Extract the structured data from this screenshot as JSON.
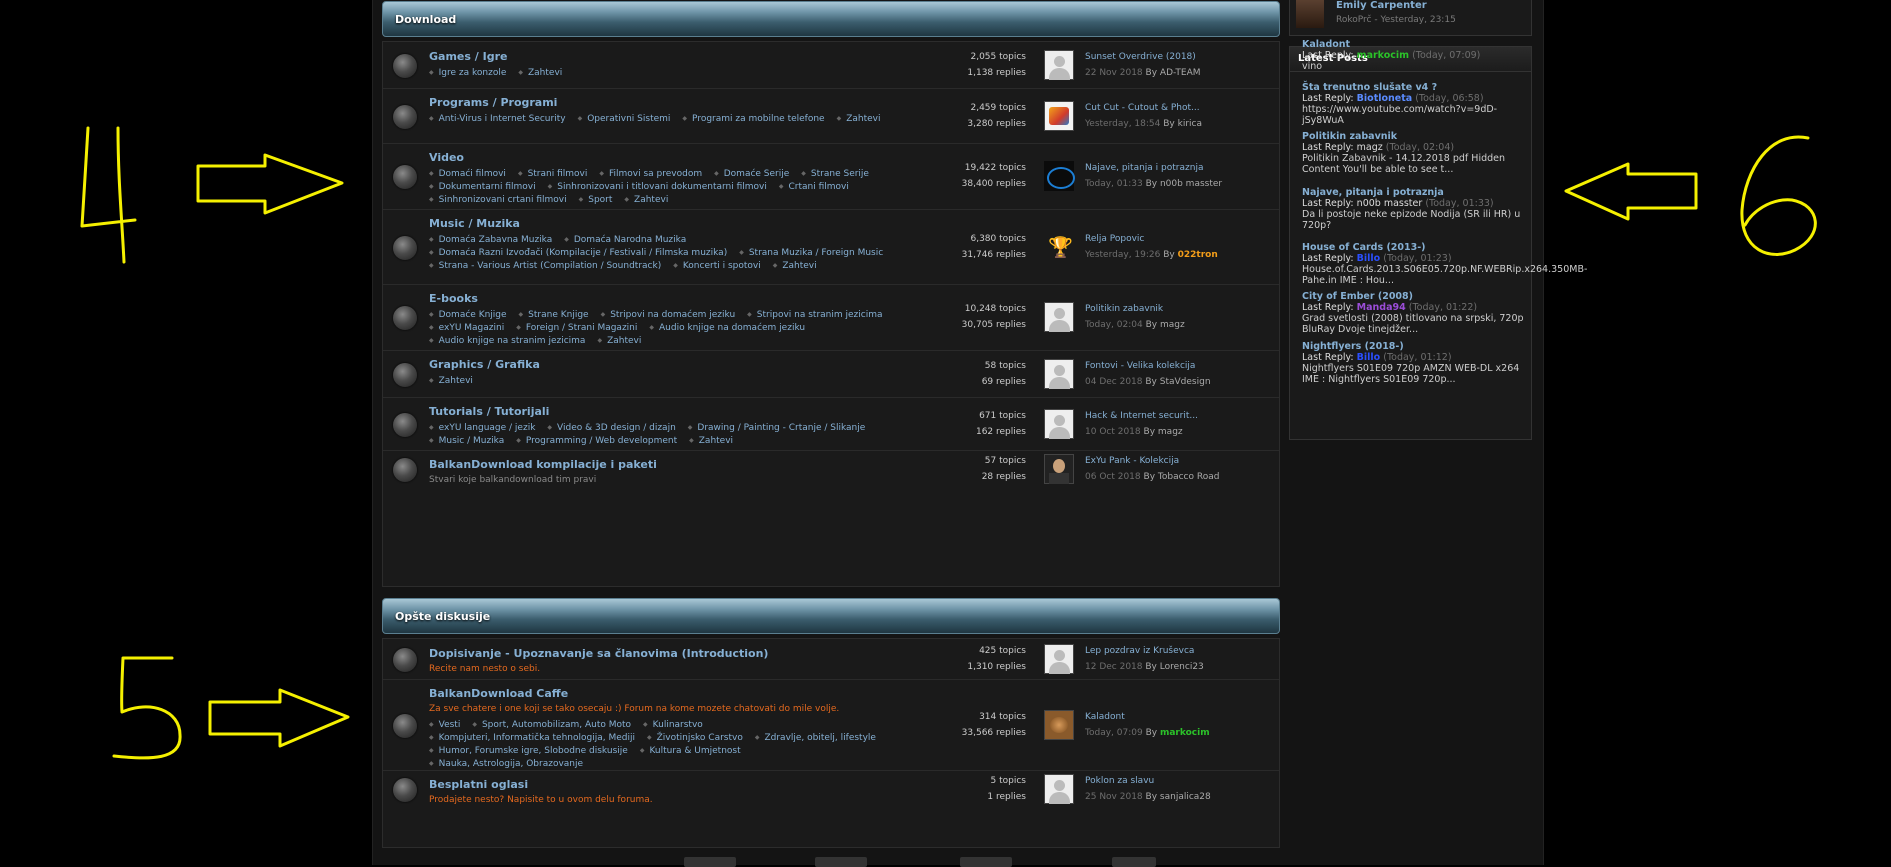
{
  "annotations": {
    "n4": "4",
    "n5": "5",
    "n6": "6"
  },
  "top_user": {
    "name": "Emily Carpenter",
    "sub": "RokoPrč - Yesterday, 23:15"
  },
  "download": {
    "header": "Download",
    "forums": [
      {
        "title": "Games / Igre",
        "subs": [
          "Igre za konzole",
          "Zahtevi"
        ],
        "topics": "2,055 topics",
        "replies": "1,138 replies",
        "last_title": "Sunset Overdrive (2018)",
        "last_date": "22 Nov 2018",
        "by": "By",
        "last_user": "AD-TEAM",
        "avatar": "default"
      },
      {
        "title": "Programs / Programi",
        "subs": [
          "Anti-Virus i Internet Security",
          "Operativni Sistemi",
          "Programi za mobilne telefone",
          "Zahtevi"
        ],
        "topics": "2,459 topics",
        "replies": "3,280 replies",
        "last_title": "Cut Cut - Cutout & Phot...",
        "last_date": "Yesterday, 18:54",
        "by": "By",
        "last_user": "kirica",
        "avatar": "cut"
      },
      {
        "title": "Video",
        "subs": [
          "Domaći filmovi",
          "Strani filmovi",
          "Filmovi sa prevodom",
          "Domaće Serije",
          "Strane Serije",
          "Dokumentarni filmovi",
          "Sinhronizovani i titlovani dokumentarni filmovi",
          "Crtani filmovi",
          "Sinhronizovani crtani filmovi",
          "Sport",
          "Zahtevi"
        ],
        "topics": "19,422 topics",
        "replies": "38,400 replies",
        "last_title": "Najave, pitanja i potraznja",
        "last_date": "Today, 01:33",
        "by": "By",
        "last_user": "n00b masster",
        "avatar": "intel"
      },
      {
        "title": "Music / Muzika",
        "subs": [
          "Domaća Zabavna Muzika",
          "Domaća Narodna Muzika",
          "Domaća Razni Izvođači (Kompilacije / Festivali / Filmska muzika)",
          "Strana Muzika / Foreign Music",
          "Strana - Various Artist (Compilation / Soundtrack)",
          "Koncerti i spotovi",
          "Zahtevi"
        ],
        "topics": "6,380 topics",
        "replies": "31,746 replies",
        "last_title": "Relja Popovic",
        "last_date": "Yesterday, 19:26",
        "by": "By",
        "last_user": "022tron",
        "avatar": "cup",
        "user_style": "orange"
      },
      {
        "title": "E-books",
        "subs": [
          "Domaće Knjige",
          "Strane Knjige",
          "Stripovi na domaćem jeziku",
          "Stripovi na stranim jezicima",
          "exYU Magazini",
          "Foreign / Strani Magazini",
          "Audio knjige na domaćem jeziku",
          "Audio knjige na stranim jezicima",
          "Zahtevi"
        ],
        "topics": "10,248 topics",
        "replies": "30,705 replies",
        "last_title": "Politikin zabavnik",
        "last_date": "Today, 02:04",
        "by": "By",
        "last_user": "magz",
        "avatar": "default"
      },
      {
        "title": "Graphics / Grafika",
        "subs": [
          "Zahtevi"
        ],
        "topics": "58 topics",
        "replies": "69 replies",
        "last_title": "Fontovi - Velika kolekcija",
        "last_date": "04 Dec 2018",
        "by": "By",
        "last_user": "StaVdesign",
        "avatar": "default"
      },
      {
        "title": "Tutorials / Tutorijali",
        "subs": [
          "exYU language / jezik",
          "Video & 3D design / dizajn",
          "Drawing / Painting - Crtanje / Slikanje",
          "Music / Muzika",
          "Programming / Web development",
          "Zahtevi"
        ],
        "topics": "671 topics",
        "replies": "162 replies",
        "last_title": "Hack & Internet securit...",
        "last_date": "10 Oct 2018",
        "by": "By",
        "last_user": "magz",
        "avatar": "default"
      },
      {
        "title": "BalkanDownload kompilacije i paketi",
        "desc": "Stvari koje balkandownload tim pravi",
        "topics": "57 topics",
        "replies": "28 replies",
        "last_title": "ExYu Pank - Kolekcija",
        "last_date": "06 Oct 2018",
        "by": "By",
        "last_user": "Tobacco Road",
        "avatar": "dark"
      }
    ]
  },
  "general": {
    "header": "Opšte diskusije",
    "forums": [
      {
        "title": "Dopisivanje - Upoznavanje sa članovima (Introduction)",
        "desc": "Recite nam nesto o sebi.",
        "topics": "425 topics",
        "replies": "1,310 replies",
        "last_title": "Lep pozdrav iz Kruševca",
        "last_date": "12 Dec 2018",
        "by": "By",
        "last_user": "Lorenci23",
        "avatar": "default"
      },
      {
        "title": "BalkanDownload Caffe",
        "desc": "Za sve chatere i one koji se tako osecaju :) Forum na kome mozete chatovati do mile volje.",
        "subs": [
          "Vesti",
          "Sport, Automobilizam, Auto Moto",
          "Kulinarstvo",
          "Kompjuteri, Informatička tehnologija, Mediji",
          "Životinjsko Carstvo",
          "Zdravlje, obitelj, lifestyle",
          "Humor, Forumske igre, Slobodne diskusije",
          "Kultura & Umjetnost",
          "Nauka, Astrologija, Obrazovanje"
        ],
        "topics": "314 topics",
        "replies": "33,566 replies",
        "last_title": "Kaladont",
        "last_date": "Today, 07:09",
        "by": "By",
        "last_user": "markocim",
        "avatar": "cat",
        "user_style": "green"
      },
      {
        "title": "Besplatni oglasi",
        "desc": "Prodajete nesto? Napisite to u ovom delu foruma.",
        "topics": "5 topics",
        "replies": "1 replies",
        "last_title": "Poklon za slavu",
        "last_date": "25 Nov 2018",
        "by": "By",
        "last_user": "sanjalica28",
        "avatar": "default"
      }
    ]
  },
  "latest_posts": {
    "header": "Latest Posts",
    "items": [
      {
        "title": "Kaladont",
        "label": "Last Reply:",
        "user": "markocim",
        "user_style": "green",
        "time": "(Today, 07:09)",
        "text": "vino"
      },
      {
        "title": "Šta trenutno slušate v4 ?",
        "label": "Last Reply:",
        "user": "Biotloneta",
        "user_style": "blue",
        "time": "(Today, 06:58)",
        "text": "https://www.youtube.com/watch?v=9dD-jSy8WuA"
      },
      {
        "title": "Politikin zabavnik",
        "label": "Last Reply:",
        "user": "magz",
        "user_style": "plain",
        "time": "(Today, 02:04)",
        "text": "Politikin Zabavnik - 14.12.2018 pdf Hidden Content You'll be able to see t..."
      },
      {
        "title": "Najave, pitanja i potraznja",
        "label": "Last Reply:",
        "user": "n00b masster",
        "user_style": "plain",
        "time": "(Today, 01:33)",
        "text": "Da li postoje neke epizode Nodija (SR ili HR) u 720p?"
      },
      {
        "title": "House of Cards (2013-)",
        "label": "Last Reply:",
        "user": "Billo",
        "user_style": "blue2",
        "time": "(Today, 01:23)",
        "text": "House.of.Cards.2013.S06E05.720p.NF.WEBRip.x264.350MB-Pahe.in   IME : Hou..."
      },
      {
        "title": "City of Ember (2008)",
        "label": "Last Reply:",
        "user": "Manda94",
        "user_style": "purple",
        "time": "(Today, 01:22)",
        "text": "Grad svetlosti (2008) titlovano na srpski, 720p BluRay   Dvoje tinejdžer..."
      },
      {
        "title": "Nightflyers (2018-)",
        "label": "Last Reply:",
        "user": "Billo",
        "user_style": "blue2",
        "time": "(Today, 01:12)",
        "text": "Nightflyers S01E09 720p AMZN WEB-DL x264   IME : Nightflyers S01E09 720p..."
      }
    ]
  }
}
